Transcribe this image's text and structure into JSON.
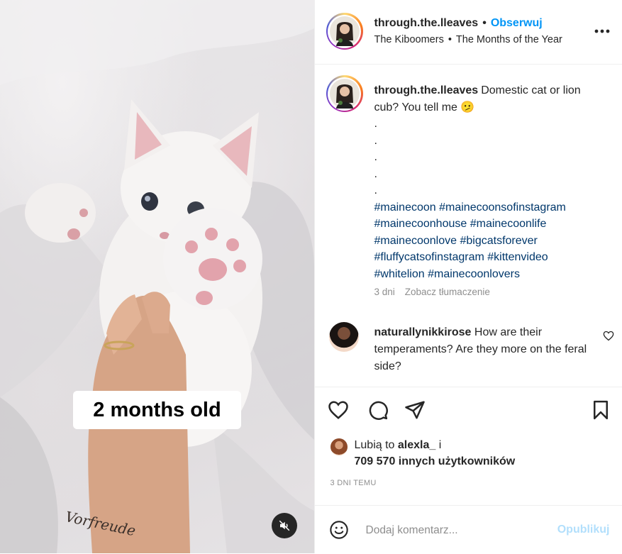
{
  "media": {
    "overlay_text": "2 months old",
    "tattoo_text": "Vorfreude"
  },
  "header": {
    "username": "through.the.lleaves",
    "separator": "•",
    "follow_label": "Obserwuj",
    "audio_artist": "The Kiboomers",
    "audio_separator": "•",
    "audio_title": "The Months of the Year",
    "more_icon": "ellipsis-icon"
  },
  "caption": {
    "username": "through.the.lleaves",
    "text": "Domestic cat or lion cub? You tell me 🫤",
    "dots": [
      ".",
      ".",
      ".",
      ".",
      "."
    ],
    "hashtags": "#mainecoon #mainecoonsofinstagram #mainecoonhouse #mainecoonlife #mainecoonlove #bigcatsforever #fluffycatsofinstagram #kittenvideo #whitelion #mainecoonlovers",
    "age": "3 dni",
    "translate_label": "Zobacz tłumaczenie"
  },
  "comment": {
    "username": "naturallynikkirose",
    "text": "How are their temperaments? Are they more on the feral side?"
  },
  "likes": {
    "prefix": "Lubią to",
    "user": "alexla_",
    "suffix": "i",
    "count_text": "709 570 innych użytkowników"
  },
  "timestamp": "3 DNI TEMU",
  "add_comment": {
    "placeholder": "Dodaj komentarz...",
    "publish_label": "Opublikuj"
  },
  "colors": {
    "link_blue": "#0095f6",
    "hashtag_blue": "#00376b",
    "muted_text": "#8e8e8e",
    "publish_disabled": "#b2dffc"
  }
}
